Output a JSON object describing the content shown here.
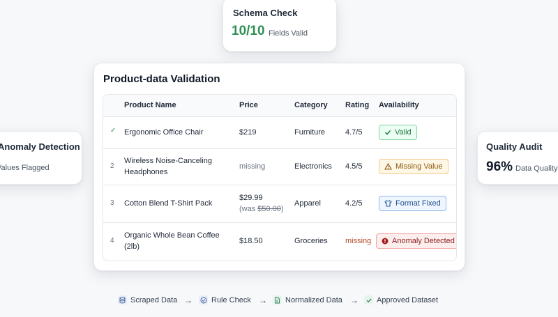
{
  "schema_card": {
    "title": "Schema Check",
    "score": "10/10",
    "caption": "Fields Valid"
  },
  "anomaly_card": {
    "title": "Anomaly Detection",
    "caption": "Values Flagged"
  },
  "audit_card": {
    "title": "Quality Audit",
    "score": "96%",
    "caption": "Data Quality Score"
  },
  "validation": {
    "title": "Product-data Validation",
    "headers": {
      "name": "Product Name",
      "price": "Price",
      "category": "Category",
      "rating": "Rating",
      "availability": "Availability"
    },
    "rows": [
      {
        "index": "✓",
        "name_line1": "Ergonomic Office Chair",
        "name_line2": "",
        "price": "$219",
        "price_note": "",
        "category": "Furniture",
        "rating": "4.7/5",
        "status": "Valid",
        "status_type": "valid"
      },
      {
        "index": "2",
        "name_line1": "Wireless Noise-Canceling",
        "name_line2": "Headphones",
        "price": "missing",
        "price_note": "",
        "category": "Electronics",
        "rating": "4.5/5",
        "status": "Missing Value",
        "status_type": "warn"
      },
      {
        "index": "3",
        "name_line1": "Cotton Blend T-Shirt Pack",
        "name_line2": "",
        "price": "$29.99",
        "price_note_prefix": "(was ",
        "price_note": "$50.00",
        "price_note_suffix": ")",
        "category": "Apparel",
        "rating": "4.2/5",
        "status": "Format Fixed",
        "status_type": "info"
      },
      {
        "index": "4",
        "name_line1": "Organic Whole Bean Coffee",
        "name_line2": "(2lb)",
        "price": "$18.50",
        "price_note": "",
        "category": "Groceries",
        "rating": "missing",
        "status": "Anomaly Detected",
        "status_type": "err"
      }
    ]
  },
  "pipeline": [
    {
      "label": "Scraped Data",
      "icon": "database-icon"
    },
    {
      "label": "Rule Check",
      "icon": "shield-check-icon"
    },
    {
      "label": "Normalized Data",
      "icon": "document-icon"
    },
    {
      "label": "Approved Dataset",
      "icon": "check-icon"
    }
  ],
  "colors": {
    "accent_green": "#2f8f55",
    "background": "#f6f8fa"
  }
}
